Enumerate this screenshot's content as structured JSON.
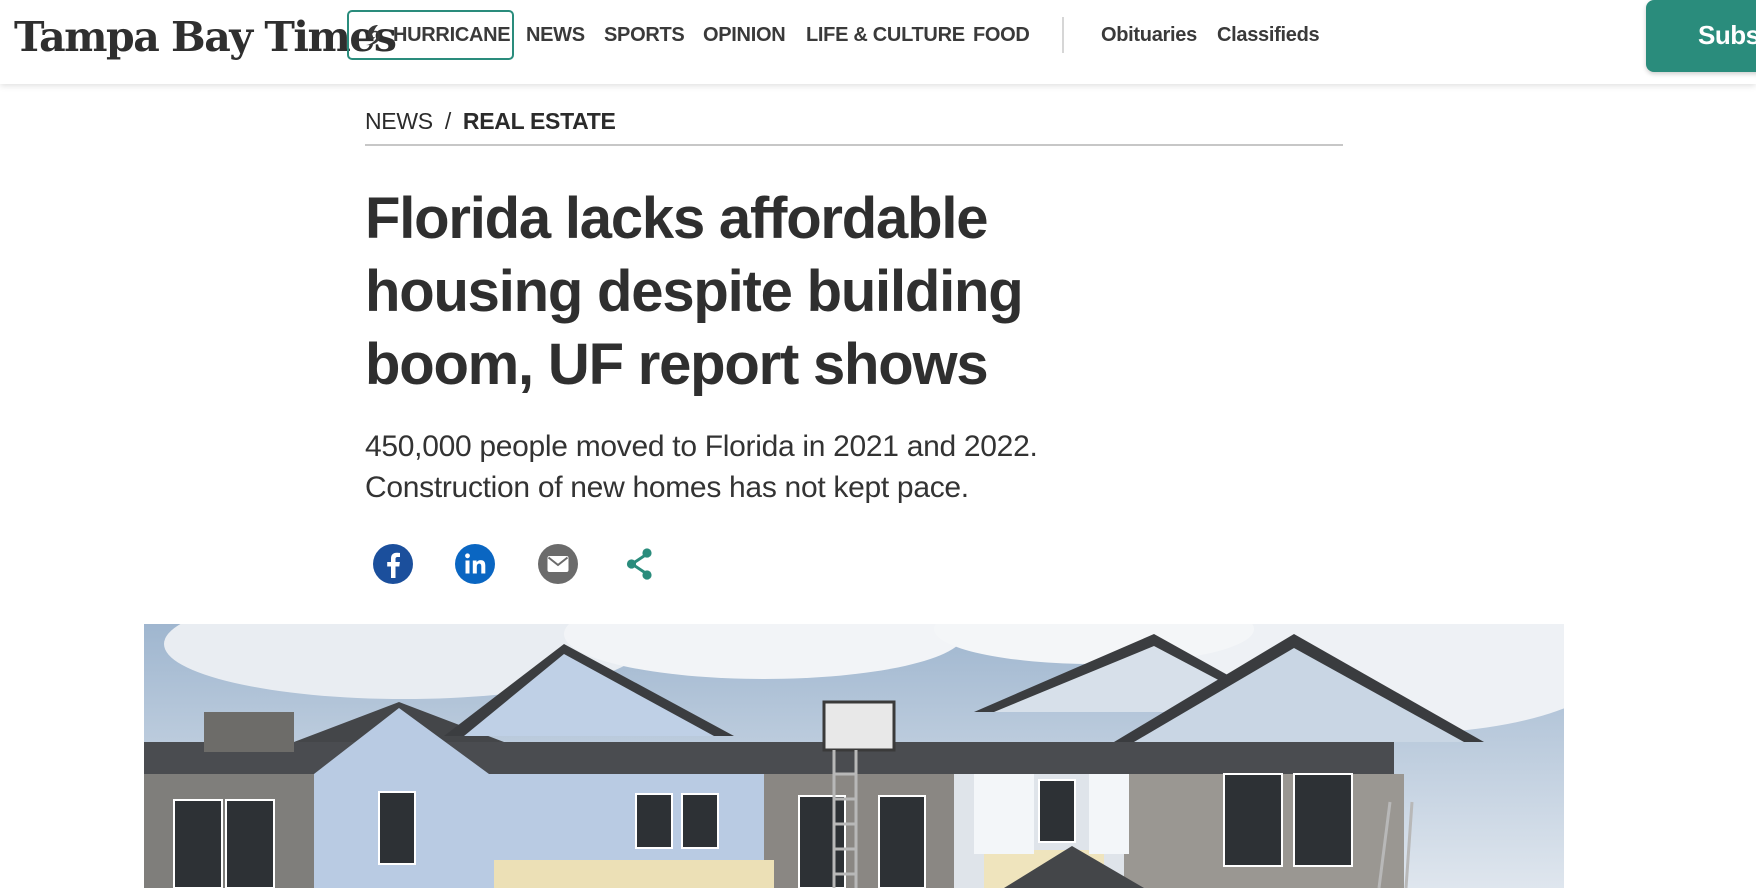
{
  "header": {
    "logo_text": "Tampa Bay Times",
    "hurricane_label": "HURRICANE",
    "nav_primary": [
      "NEWS",
      "SPORTS",
      "OPINION",
      "LIFE & CULTURE",
      "FOOD"
    ],
    "nav_secondary": [
      "Obituaries",
      "Classifieds"
    ],
    "subscribe_label": "Subs",
    "accent_color": "#2a8c7c"
  },
  "breadcrumb": {
    "section": "NEWS",
    "separator": "/",
    "subsection": "REAL ESTATE"
  },
  "article": {
    "headline": "Florida lacks affordable housing despite building boom, UF report shows",
    "dek": "450,000 people moved to Florida in 2021 and 2022. Construction of new homes has not kept pace."
  },
  "share": {
    "icons": [
      "facebook-icon",
      "linkedin-icon",
      "email-icon",
      "share-icon"
    ],
    "colors": {
      "facebook": "#1b4f9c",
      "linkedin": "#0a66c2",
      "email": "#6b6b6b",
      "share": "#2a8c7c"
    }
  },
  "hero_image": {
    "subject": "townhouse-construction-photo"
  }
}
